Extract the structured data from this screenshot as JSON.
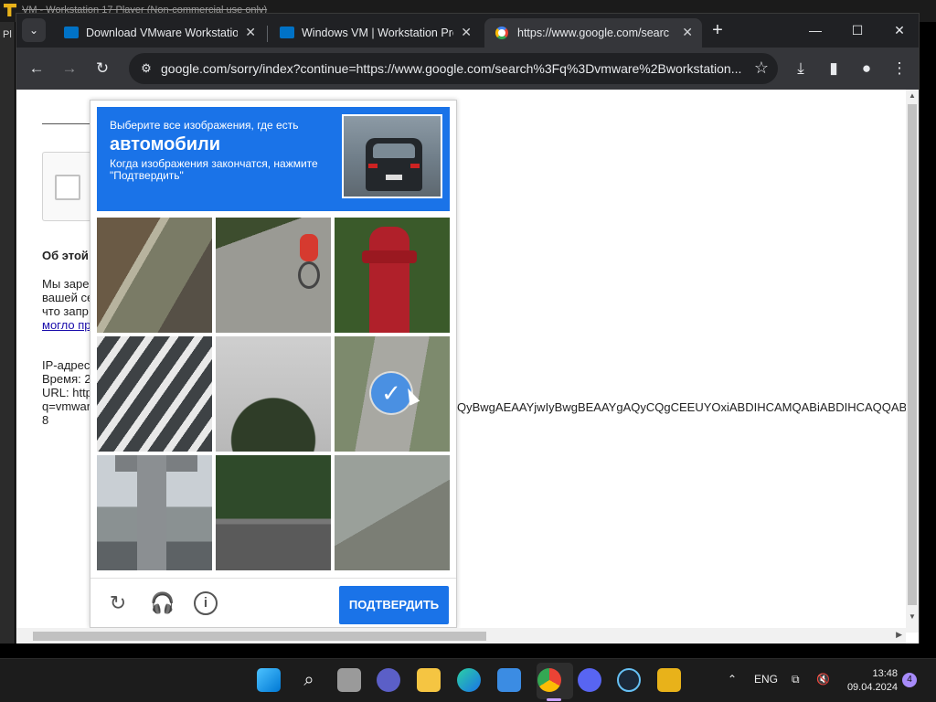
{
  "vm": {
    "title": "VM - Workstation 17 Player (Non-commercial use only)",
    "left_label": "Pl"
  },
  "browser": {
    "tabs": [
      {
        "title": "Download VMware Workstation Pro",
        "favicon": "vmware-favicon"
      },
      {
        "title": "Windows VM | Workstation Pro",
        "favicon": "vmware-favicon"
      },
      {
        "title": "https://www.google.com/search",
        "favicon": "google-favicon",
        "active": true
      }
    ],
    "url": "google.com/sorry/index?continue=https://www.google.com/search%3Fq%3Dvmware%2Bworkstation..."
  },
  "page": {
    "about_heading": "Об этой",
    "para_lines": [
      "Мы заре",
      "вашей се",
      "что запр"
    ],
    "para_link": "могло пр",
    "meta_lines": [
      "IP-адрес",
      "Время: 2",
      "URL: http",
      "q=vmwar",
      "8"
    ],
    "long_url_tail": "QyBwgAEAAYjwIyBwgBEAAYgAQyCQgCEEUYOxiABDIHCAMQABiABDIHCAQQAB"
  },
  "captcha": {
    "instruction": "Выберите все изображения, где есть",
    "target": "автомобили",
    "note": "Когда изображения закончатся, нажмите \"Подтвердить\"",
    "tiles": [
      "rail-track",
      "cyclist-road",
      "fire-hydrant",
      "crosswalk",
      "shrub",
      "road-selected",
      "bridge-pillar",
      "road-guardrail",
      "windshield"
    ],
    "selected_tile": 6,
    "verify_label": "ПОДТВЕРДИТЬ"
  },
  "taskbar": {
    "lang": "ENG",
    "time": "13:48",
    "date": "09.04.2024",
    "notifications": "4"
  }
}
